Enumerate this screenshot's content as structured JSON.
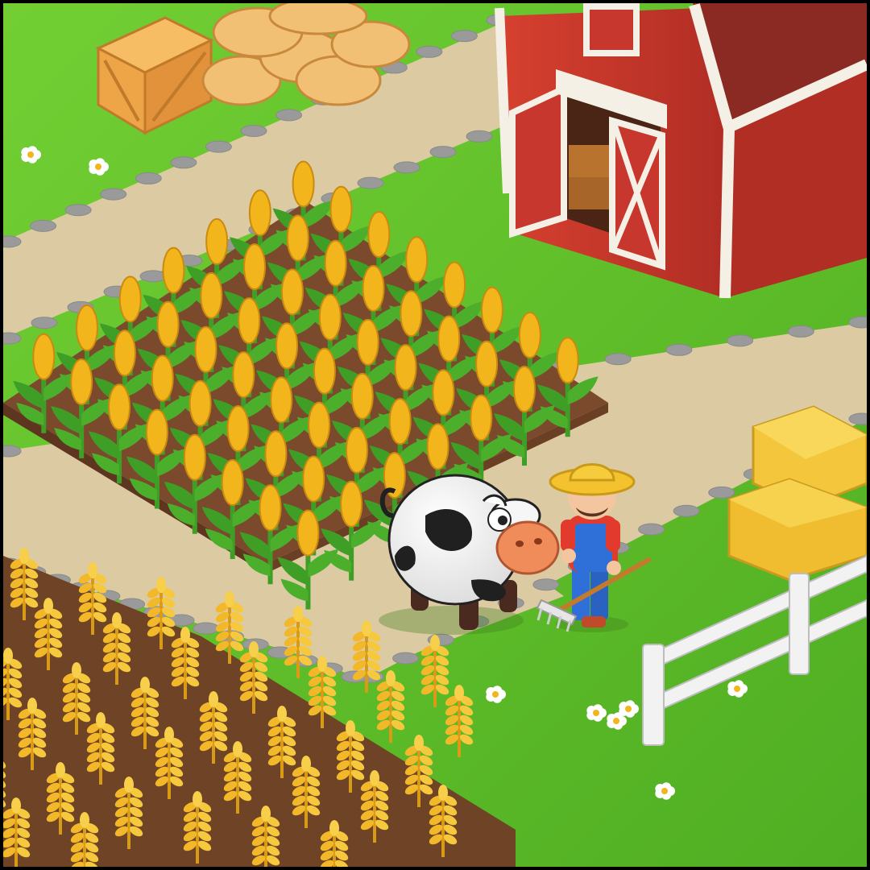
{
  "scene": {
    "type": "farm-game-scene",
    "frame_color": "#000000",
    "colors": {
      "grass": "#5fbf2a",
      "grass_light": "#7fd53a",
      "path": "#dccba2",
      "path_stone": "#9a9a9a",
      "soil": "#7b4a2c",
      "soil_dark": "#5e3620",
      "corn_cob": "#f3b51c",
      "corn_leaf": "#3f9e25",
      "wheat": "#f2b82a",
      "barn_red": "#c8372d",
      "barn_trim": "#f4f0e6",
      "barn_roof": "#8a2a22",
      "crate": "#efa84a",
      "sack": "#f2c074",
      "hay": "#f3c63c",
      "fence": "#f2f2f2",
      "farmer_hat": "#f3c22e",
      "farmer_shirt": "#e23b2e",
      "farmer_overalls": "#2f6fd8",
      "cow_body": "#f6f6f6",
      "cow_spot": "#202020",
      "cow_snout": "#f08c5a"
    },
    "elements": [
      "barn",
      "wooden-crate",
      "grain-sacks",
      "corn-field",
      "wheat-field",
      "cow",
      "farmer",
      "rake",
      "hay-bales",
      "white-fence",
      "flowers",
      "stone-path"
    ],
    "grid": {
      "corn_rows": 7,
      "corn_cols": 8,
      "wheat_rows": 6,
      "wheat_cols": 7
    }
  }
}
